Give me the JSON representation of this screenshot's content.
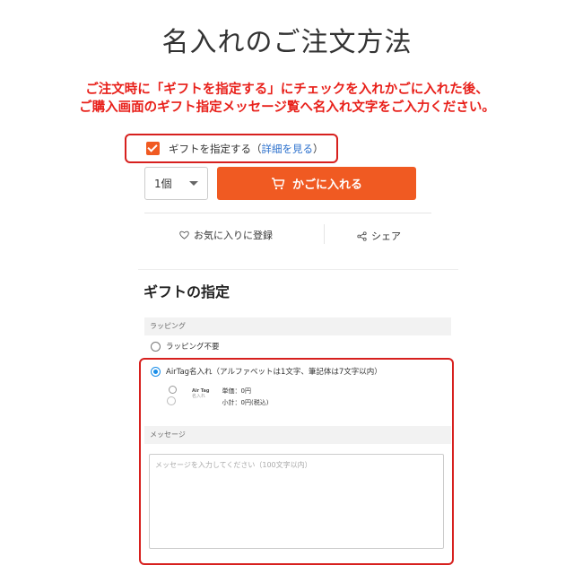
{
  "page": {
    "title": "名入れのご注文方法",
    "note_line1": "ご注文時に「ギフトを指定する」にチェックを入れかごに入れた後、",
    "note_line2": "ご購入画面のギフト指定メッセージ覧へ名入れ文字をご入力ください。"
  },
  "gift_option": {
    "label": "ギフトを指定する（",
    "link": "詳細を見る",
    "close": "）",
    "checked": true
  },
  "purchase": {
    "quantity": "1個",
    "add_to_cart": "かごに入れる",
    "favorite": "お気に入りに登録",
    "share": "シェア"
  },
  "gift_panel": {
    "title": "ギフトの指定",
    "wrapping_section": "ラッピング",
    "option_none": "ラッピング不要",
    "option_airtag": "AirTag名入れ（アルファベットは1文字、筆記体は7文字以内）",
    "selected": "option_airtag",
    "thumb_label": "Air Tag",
    "thumb_sub": "名入れ",
    "unit_price": "単価：0円",
    "subtotal": "小計：0円(税込)",
    "message_section": "メッセージ",
    "message_placeholder": "メッセージを入力してください（100文字以内）"
  },
  "colors": {
    "accent_orange": "#f05a22",
    "highlight_red": "#d7201e",
    "note_red": "#e8201a",
    "link_blue": "#2a6fcc",
    "radio_blue": "#1a8ee8"
  }
}
